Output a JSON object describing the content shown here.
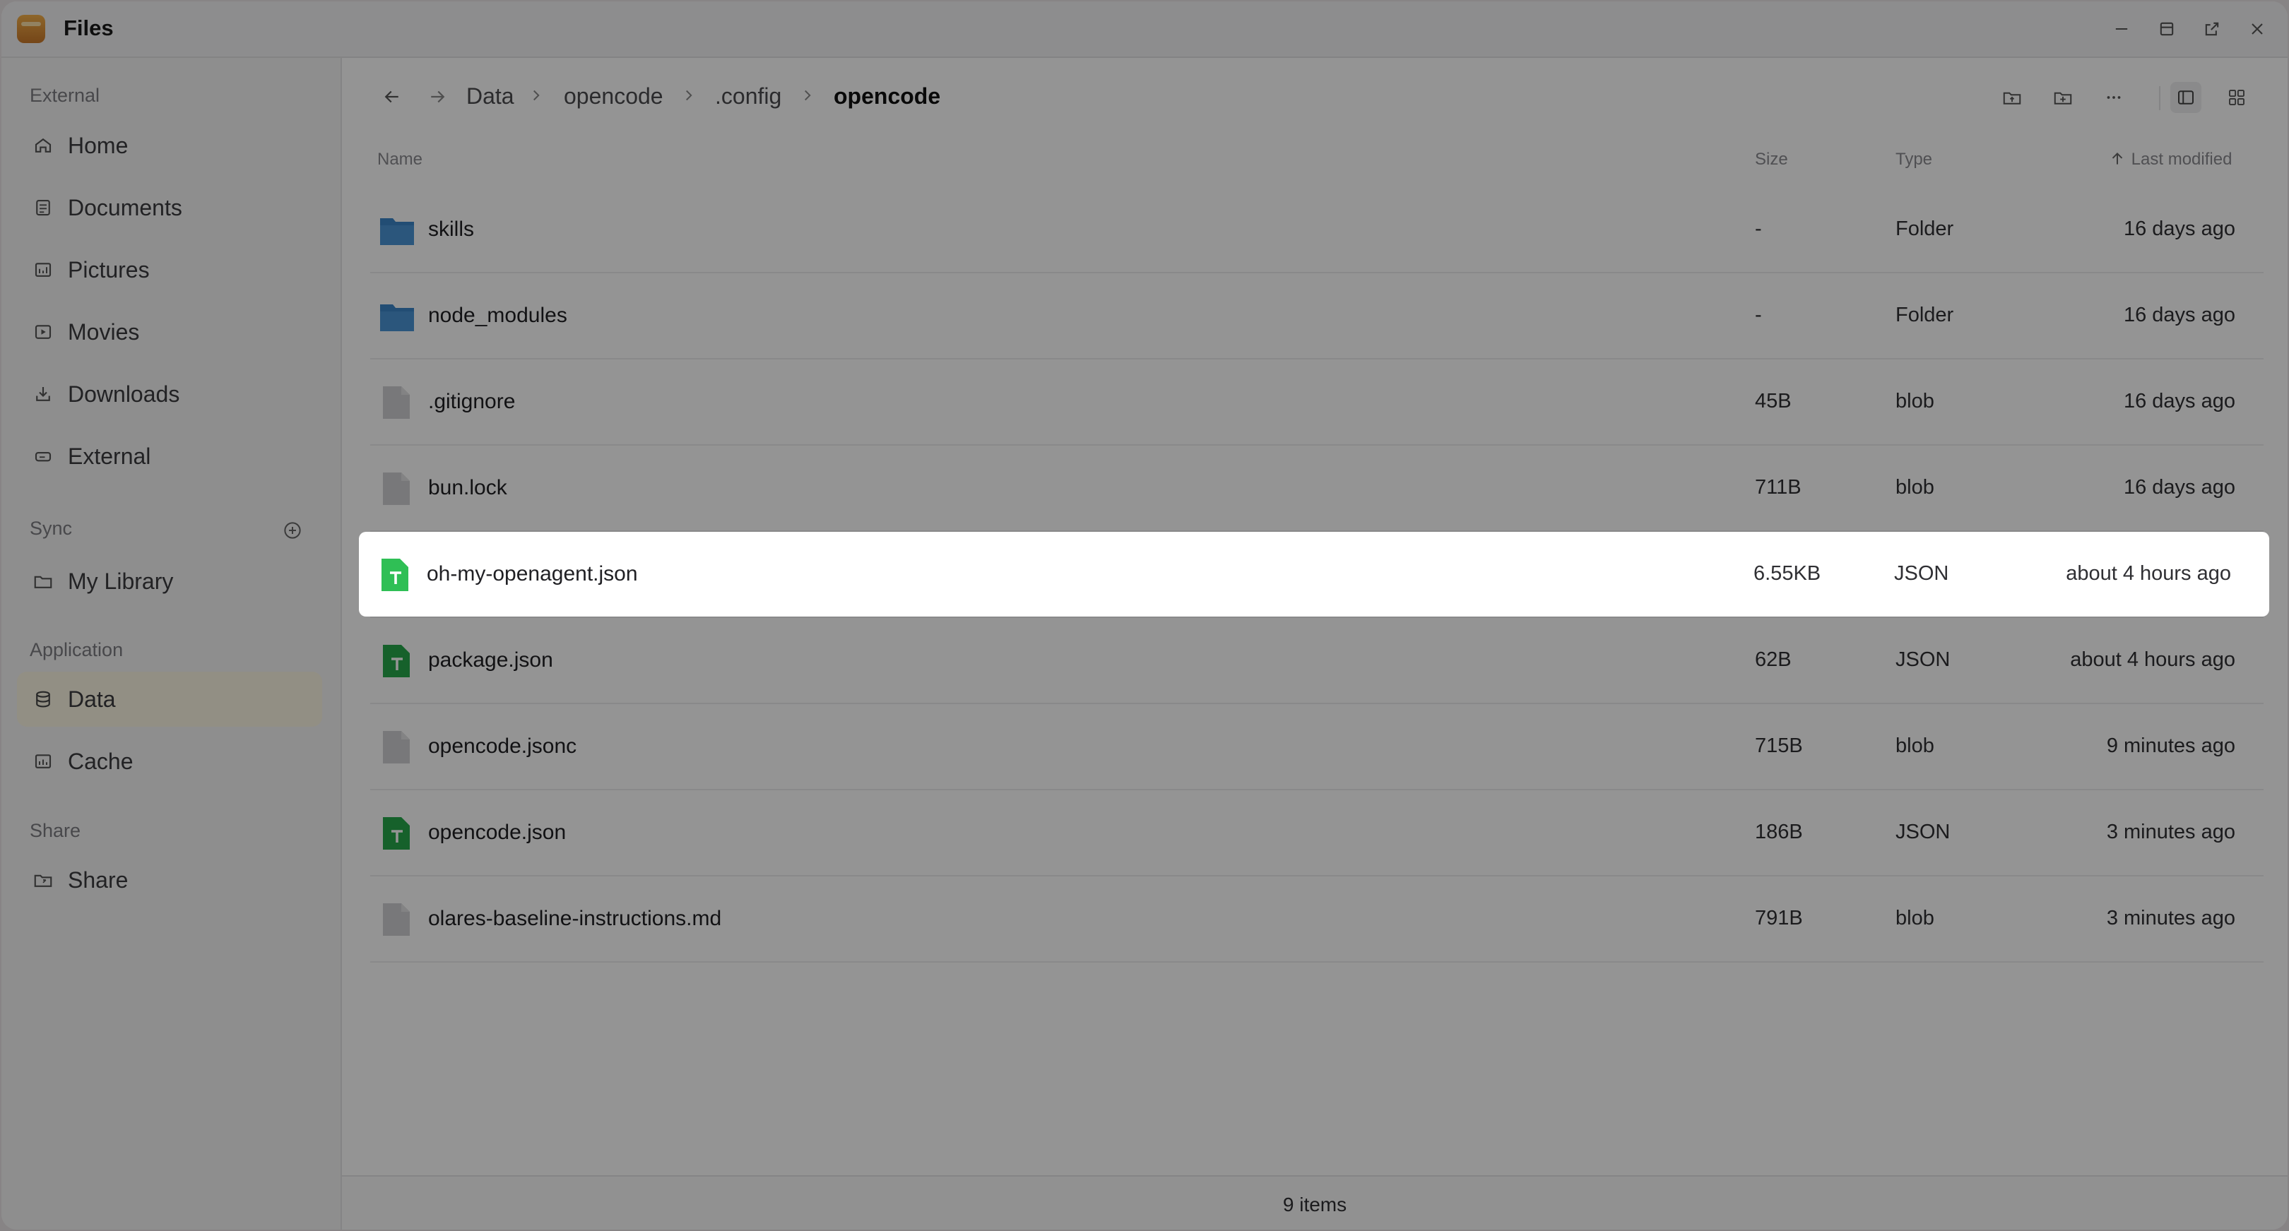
{
  "app": {
    "title": "Files"
  },
  "sidebar": {
    "sections": [
      {
        "title": "External",
        "items": [
          {
            "label": "Home",
            "icon": "home-icon"
          },
          {
            "label": "Documents",
            "icon": "document-icon"
          },
          {
            "label": "Pictures",
            "icon": "pictures-icon"
          },
          {
            "label": "Movies",
            "icon": "movie-icon"
          },
          {
            "label": "Downloads",
            "icon": "download-icon"
          },
          {
            "label": "External",
            "icon": "drive-icon"
          }
        ]
      },
      {
        "title": "Sync",
        "items": [
          {
            "label": "My Library",
            "icon": "folder-icon"
          }
        ]
      },
      {
        "title": "Application",
        "items": [
          {
            "label": "Data",
            "icon": "database-icon",
            "active": true
          },
          {
            "label": "Cache",
            "icon": "cache-icon"
          }
        ]
      },
      {
        "title": "Share",
        "items": [
          {
            "label": "Share",
            "icon": "share-folder-icon"
          }
        ]
      }
    ]
  },
  "breadcrumb": [
    "Data",
    "opencode",
    ".config",
    "opencode"
  ],
  "columns": {
    "name": "Name",
    "size": "Size",
    "type": "Type",
    "modified": "Last modified"
  },
  "files": [
    {
      "name": "skills",
      "size": "-",
      "type": "Folder",
      "modified": "16 days ago",
      "kind": "folder"
    },
    {
      "name": "node_modules",
      "size": "-",
      "type": "Folder",
      "modified": "16 days ago",
      "kind": "folder"
    },
    {
      "name": ".gitignore",
      "size": "45B",
      "type": "blob",
      "modified": "16 days ago",
      "kind": "blob"
    },
    {
      "name": "bun.lock",
      "size": "711B",
      "type": "blob",
      "modified": "16 days ago",
      "kind": "blob"
    },
    {
      "name": "oh-my-openagent.json",
      "size": "6.55KB",
      "type": "JSON",
      "modified": "about 4 hours ago",
      "kind": "json",
      "highlighted": true
    },
    {
      "name": "package.json",
      "size": "62B",
      "type": "JSON",
      "modified": "about 4 hours ago",
      "kind": "json"
    },
    {
      "name": "opencode.jsonc",
      "size": "715B",
      "type": "blob",
      "modified": "9 minutes ago",
      "kind": "blob"
    },
    {
      "name": "opencode.json",
      "size": "186B",
      "type": "JSON",
      "modified": "3 minutes ago",
      "kind": "json"
    },
    {
      "name": "olares-baseline-instructions.md",
      "size": "791B",
      "type": "blob",
      "modified": "3 minutes ago",
      "kind": "blob"
    }
  ],
  "footer": {
    "count": "9 items"
  },
  "colors": {
    "folder": "#3b86c9",
    "json": "#27a84a",
    "blob": "#cfcfd2",
    "active_item": "#fcf6e3"
  }
}
